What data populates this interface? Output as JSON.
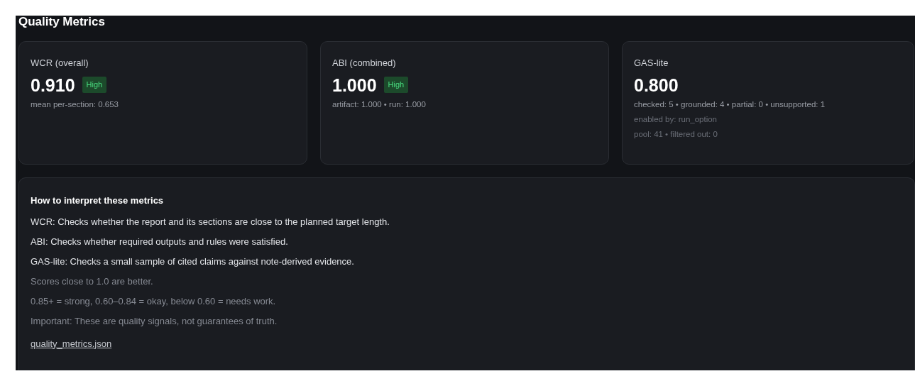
{
  "title": "Quality Metrics",
  "cards": [
    {
      "label": "WCR (overall)",
      "value": "0.910",
      "badge": "High",
      "details": [
        {
          "text": "mean per-section: 0.653",
          "muted": false
        }
      ]
    },
    {
      "label": "ABI (combined)",
      "value": "1.000",
      "badge": "High",
      "details": [
        {
          "text": "artifact: 1.000 • run: 1.000",
          "muted": false
        }
      ]
    },
    {
      "label": "GAS-lite",
      "value": "0.800",
      "details": [
        {
          "text": "checked: 5 • grounded: 4 • partial: 0 • unsupported: 1",
          "muted": false
        },
        {
          "text": "enabled by: run_option",
          "muted": true
        },
        {
          "text": "pool: 41 • filtered out: 0",
          "muted": true
        }
      ]
    }
  ],
  "help": {
    "heading": "How to interpret these metrics",
    "lines": [
      {
        "text": "WCR: Checks whether the report and its sections are close to the planned target length.",
        "muted": false
      },
      {
        "text": "ABI: Checks whether required outputs and rules were satisfied.",
        "muted": false
      },
      {
        "text": "GAS-lite: Checks a small sample of cited claims against note-derived evidence.",
        "muted": false
      },
      {
        "text": "Scores close to 1.0 are better.",
        "muted": true
      },
      {
        "text": "0.85+ = strong, 0.60–0.84 = okay, below 0.60 = needs work.",
        "muted": true
      },
      {
        "text": "Important: These are quality signals, not guarantees of truth.",
        "muted": true
      }
    ],
    "link": "quality_metrics.json"
  }
}
